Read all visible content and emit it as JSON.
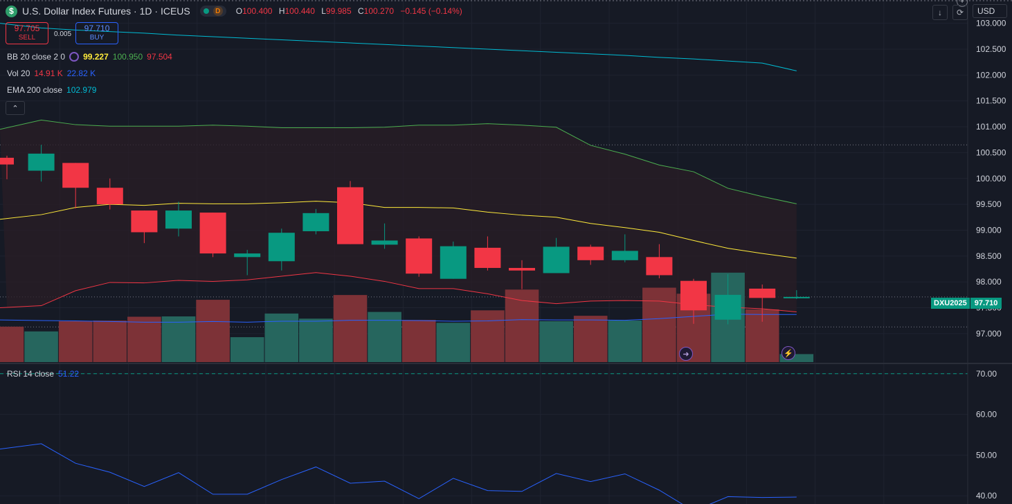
{
  "header": {
    "logo_symbol": "$",
    "title": "U.S. Dollar Index Futures · 1D · ICEUS",
    "market_badge": "D",
    "ohlc": [
      {
        "key": "O",
        "value": "100.400"
      },
      {
        "key": "H",
        "value": "100.440"
      },
      {
        "key": "L",
        "value": "99.985"
      },
      {
        "key": "C",
        "value": "100.270"
      }
    ],
    "change": "−0.145 (−0.14%)"
  },
  "trade": {
    "sell_price": "97.705",
    "sell_label": "SELL",
    "spread": "0.005",
    "buy_price": "97.710",
    "buy_label": "BUY"
  },
  "indicators": {
    "bb": {
      "name": "BB 20 close 2 0",
      "basis": "99.227",
      "upper": "100.950",
      "lower": "97.504"
    },
    "vol": {
      "name": "Vol 20",
      "v1": "14.91 K",
      "v2": "22.82 K"
    },
    "ema": {
      "name": "EMA 200 close",
      "value": "102.979"
    },
    "rsi": {
      "name": "RSI 14 close",
      "value": "51.22"
    }
  },
  "toolbar": {
    "currency": "USD",
    "collapse_icon": "chevron-up-icon",
    "download_icon": "arrow-down-icon",
    "replay_icon": "refresh-icon",
    "add_icon": "plus-icon"
  },
  "price_tag": {
    "symbol": "DXU2025",
    "value": "97.710"
  },
  "colors": {
    "up": "#089981",
    "down": "#f23645",
    "bb_upper": "#4caf50",
    "bb_basis": "#ffeb3b",
    "bb_lower": "#f23645",
    "ema": "#00bcd4",
    "vol_ma": "#2962ff",
    "rsi": "#2962ff"
  },
  "chart_data": [
    {
      "type": "candlestick",
      "ylim": [
        96.45,
        103.45
      ],
      "y_ticks": [
        "103.000",
        "102.500",
        "102.000",
        "101.500",
        "101.000",
        "100.500",
        "100.000",
        "99.500",
        "99.000",
        "98.500",
        "98.000",
        "97.500",
        "97.000"
      ],
      "candles": [
        {
          "o": 100.4,
          "h": 100.44,
          "l": 99.985,
          "c": 100.27
        },
        {
          "o": 100.15,
          "h": 100.65,
          "l": 99.94,
          "c": 100.48
        },
        {
          "o": 100.3,
          "h": 100.3,
          "l": 99.42,
          "c": 99.82
        },
        {
          "o": 99.82,
          "h": 100.0,
          "l": 99.4,
          "c": 99.5
        },
        {
          "o": 99.38,
          "h": 99.38,
          "l": 98.75,
          "c": 98.96
        },
        {
          "o": 99.03,
          "h": 99.55,
          "l": 98.88,
          "c": 99.38
        },
        {
          "o": 99.34,
          "h": 99.34,
          "l": 98.48,
          "c": 98.55
        },
        {
          "o": 98.48,
          "h": 98.62,
          "l": 98.13,
          "c": 98.55
        },
        {
          "o": 98.4,
          "h": 99.03,
          "l": 98.22,
          "c": 98.95
        },
        {
          "o": 98.98,
          "h": 99.41,
          "l": 98.92,
          "c": 99.33
        },
        {
          "o": 99.83,
          "h": 99.95,
          "l": 98.73,
          "c": 98.73
        },
        {
          "o": 98.72,
          "h": 99.13,
          "l": 98.64,
          "c": 98.8
        },
        {
          "o": 98.84,
          "h": 98.88,
          "l": 98.1,
          "c": 98.16
        },
        {
          "o": 98.06,
          "h": 98.78,
          "l": 98.06,
          "c": 98.69
        },
        {
          "o": 98.66,
          "h": 98.88,
          "l": 98.22,
          "c": 98.27
        },
        {
          "o": 98.27,
          "h": 98.42,
          "l": 97.86,
          "c": 98.22
        },
        {
          "o": 98.17,
          "h": 98.85,
          "l": 98.17,
          "c": 98.68
        },
        {
          "o": 98.68,
          "h": 98.72,
          "l": 98.33,
          "c": 98.42
        },
        {
          "o": 98.42,
          "h": 98.92,
          "l": 98.38,
          "c": 98.6
        },
        {
          "o": 98.48,
          "h": 98.73,
          "l": 98.07,
          "c": 98.13
        },
        {
          "o": 98.02,
          "h": 98.06,
          "l": 97.19,
          "c": 97.45
        },
        {
          "o": 97.27,
          "h": 98.15,
          "l": 97.18,
          "c": 97.75
        },
        {
          "o": 97.87,
          "h": 97.95,
          "l": 97.23,
          "c": 97.69
        },
        {
          "o": 97.7,
          "h": 97.84,
          "l": 97.67,
          "c": 97.71
        }
      ],
      "bb_upper": [
        100.95,
        101.13,
        101.04,
        101.01,
        101.01,
        101.01,
        101.03,
        101.01,
        100.98,
        100.98,
        100.98,
        100.99,
        101.03,
        101.03,
        101.06,
        101.03,
        100.99,
        100.64,
        100.47,
        100.26,
        100.13,
        99.81,
        99.65,
        99.51
      ],
      "bb_basis": [
        99.21,
        99.3,
        99.44,
        99.5,
        99.48,
        99.52,
        99.51,
        99.51,
        99.53,
        99.56,
        99.53,
        99.44,
        99.44,
        99.43,
        99.35,
        99.29,
        99.25,
        99.13,
        99.05,
        98.96,
        98.8,
        98.65,
        98.55,
        98.46
      ],
      "bb_lower": [
        97.5,
        97.54,
        97.83,
        97.99,
        97.98,
        98.03,
        98.01,
        98.04,
        98.11,
        98.18,
        98.11,
        98.01,
        97.87,
        97.87,
        97.77,
        97.64,
        97.58,
        97.63,
        97.64,
        97.63,
        97.56,
        97.51,
        97.48,
        97.42
      ],
      "ema": [
        103.0,
        102.91,
        102.87,
        102.84,
        102.81,
        102.77,
        102.74,
        102.71,
        102.68,
        102.65,
        102.62,
        102.59,
        102.56,
        102.53,
        102.5,
        102.47,
        102.44,
        102.41,
        102.38,
        102.34,
        102.31,
        102.27,
        102.23,
        102.08
      ]
    },
    {
      "type": "bar",
      "name": "Vol 20",
      "ylim": [
        0,
        31000
      ],
      "values": [
        11100,
        9600,
        12800,
        13000,
        14200,
        14300,
        19500,
        7800,
        15200,
        13600,
        21000,
        15700,
        13200,
        12300,
        16200,
        22700,
        12800,
        14500,
        13000,
        23300,
        21400,
        28000,
        16500,
        2500
      ],
      "ma": [
        13200,
        13000,
        12900,
        12700,
        12500,
        12500,
        12700,
        12500,
        12800,
        12800,
        13100,
        13100,
        13000,
        12800,
        12900,
        13300,
        13200,
        13200,
        13100,
        13600,
        14300,
        15000,
        14900,
        14900
      ]
    },
    {
      "type": "line",
      "name": "RSI 14 close",
      "ylim": [
        38,
        72
      ],
      "y_ticks": [
        "70.00",
        "60.00",
        "50.00",
        "40.00"
      ],
      "overbought": 70,
      "values": [
        51.5,
        52.8,
        48.0,
        45.8,
        42.3,
        45.7,
        40.4,
        40.4,
        44.0,
        47.1,
        43.1,
        43.6,
        39.3,
        44.3,
        41.3,
        41.1,
        45.5,
        43.5,
        45.4,
        41.4,
        36.3,
        39.8,
        39.6,
        39.7
      ]
    }
  ]
}
